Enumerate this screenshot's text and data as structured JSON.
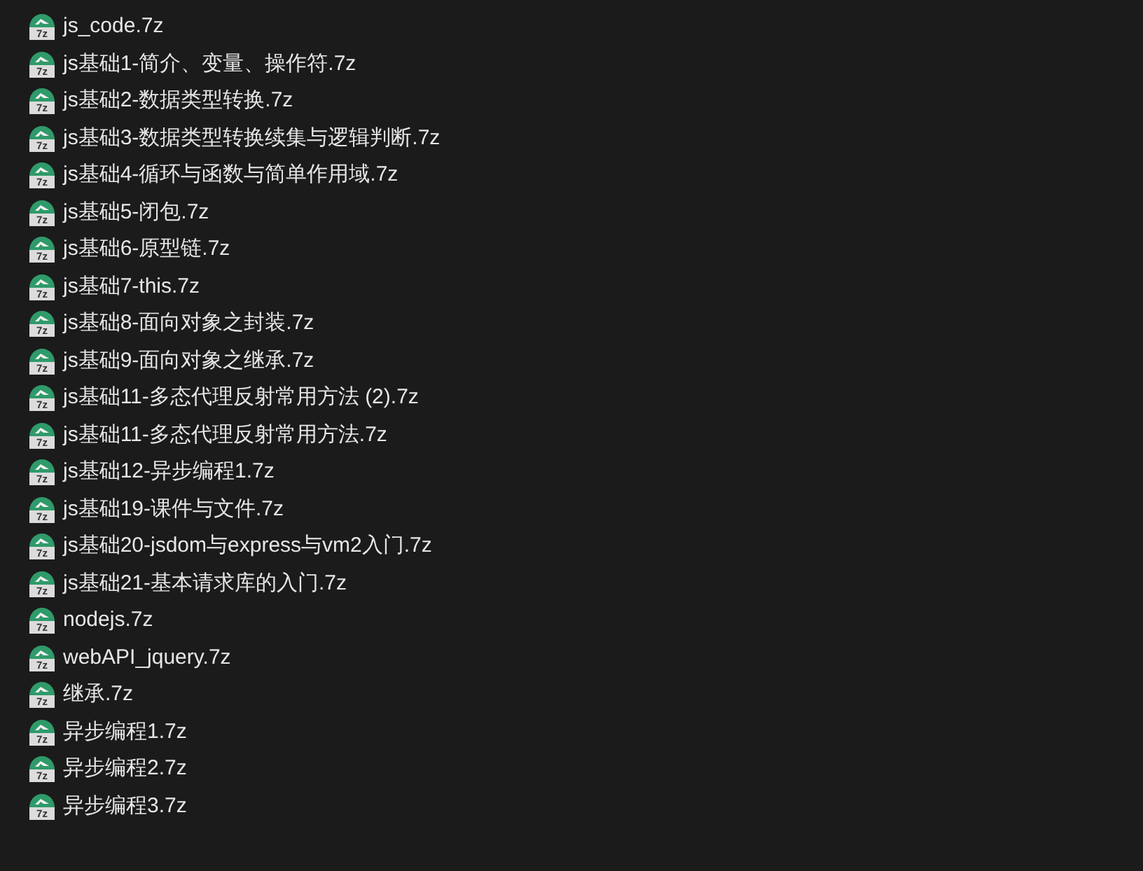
{
  "files": [
    {
      "name": "js_code.7z",
      "icon_label": "7z"
    },
    {
      "name": "js基础1-简介、变量、操作符.7z",
      "icon_label": "7z"
    },
    {
      "name": "js基础2-数据类型转换.7z",
      "icon_label": "7z"
    },
    {
      "name": "js基础3-数据类型转换续集与逻辑判断.7z",
      "icon_label": "7z"
    },
    {
      "name": "js基础4-循环与函数与简单作用域.7z",
      "icon_label": "7z"
    },
    {
      "name": "js基础5-闭包.7z",
      "icon_label": "7z"
    },
    {
      "name": "js基础6-原型链.7z",
      "icon_label": "7z"
    },
    {
      "name": "js基础7-this.7z",
      "icon_label": "7z"
    },
    {
      "name": "js基础8-面向对象之封装.7z",
      "icon_label": "7z"
    },
    {
      "name": "js基础9-面向对象之继承.7z",
      "icon_label": "7z"
    },
    {
      "name": "js基础11-多态代理反射常用方法 (2).7z",
      "icon_label": "7z"
    },
    {
      "name": "js基础11-多态代理反射常用方法.7z",
      "icon_label": "7z"
    },
    {
      "name": "js基础12-异步编程1.7z",
      "icon_label": "7z"
    },
    {
      "name": "js基础19-课件与文件.7z",
      "icon_label": "7z"
    },
    {
      "name": "js基础20-jsdom与express与vm2入门.7z",
      "icon_label": "7z"
    },
    {
      "name": "js基础21-基本请求库的入门.7z",
      "icon_label": "7z"
    },
    {
      "name": "nodejs.7z",
      "icon_label": "7z"
    },
    {
      "name": "webAPI_jquery.7z",
      "icon_label": "7z"
    },
    {
      "name": "继承.7z",
      "icon_label": "7z"
    },
    {
      "name": "异步编程1.7z",
      "icon_label": "7z"
    },
    {
      "name": "异步编程2.7z",
      "icon_label": "7z"
    },
    {
      "name": "异步编程3.7z",
      "icon_label": "7z"
    }
  ]
}
